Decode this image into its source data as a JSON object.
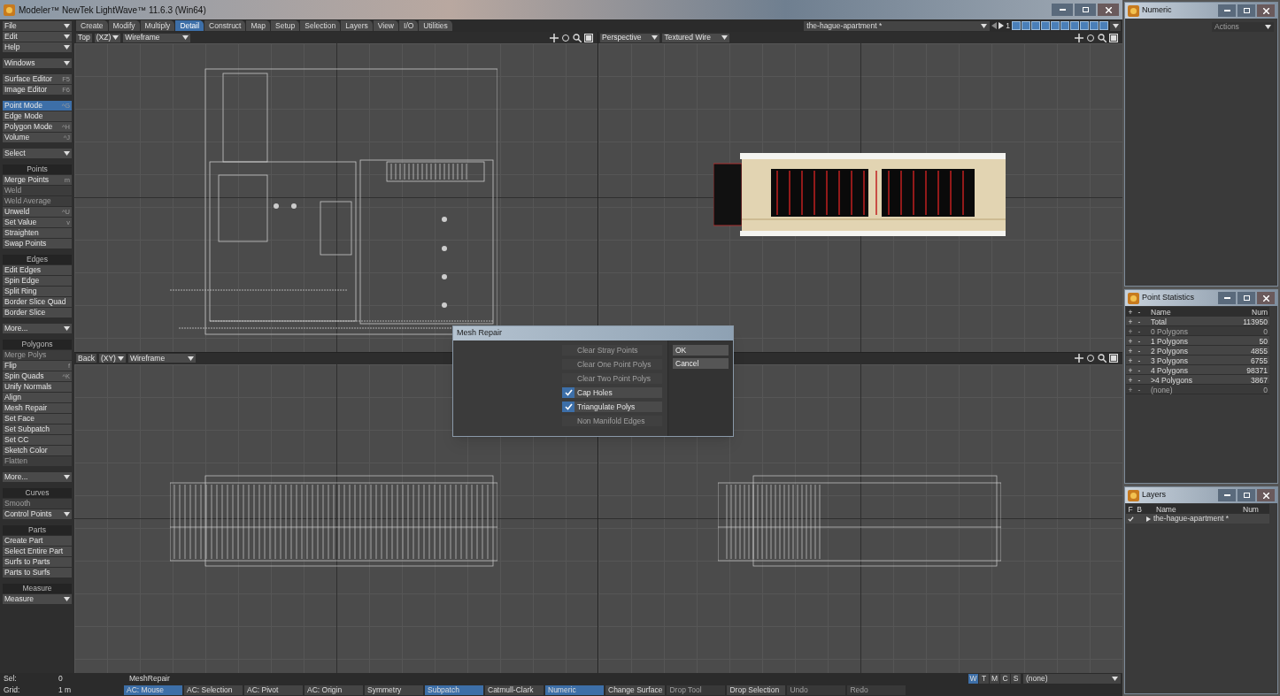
{
  "window": {
    "title": "Modeler™ NewTek LightWave™ 11.6.3 (Win64)"
  },
  "sidebar": {
    "groups": [
      {
        "items": [
          {
            "kind": "dropdown",
            "label": "File"
          },
          {
            "kind": "dropdown",
            "label": "Edit"
          },
          {
            "kind": "dropdown",
            "label": "Help"
          }
        ]
      },
      {
        "items": [
          {
            "kind": "dropdown",
            "label": "Windows"
          }
        ]
      },
      {
        "items": [
          {
            "kind": "button",
            "label": "Surface Editor",
            "shortcut": "F5",
            "selected": false,
            "disabled": false
          },
          {
            "kind": "button",
            "label": "Image Editor",
            "shortcut": "F6",
            "selected": false,
            "disabled": false
          }
        ]
      },
      {
        "items": [
          {
            "kind": "button",
            "label": "Point Mode",
            "shortcut": "^G",
            "selected": true,
            "disabled": false
          },
          {
            "kind": "button",
            "label": "Edge Mode",
            "selected": false,
            "disabled": false
          },
          {
            "kind": "button",
            "label": "Polygon Mode",
            "shortcut": "^H",
            "selected": false,
            "disabled": false
          },
          {
            "kind": "button",
            "label": "Volume",
            "shortcut": "^J",
            "selected": false,
            "disabled": false
          }
        ]
      },
      {
        "items": [
          {
            "kind": "dropdown",
            "label": "Select"
          }
        ]
      },
      {
        "items": [
          {
            "kind": "header",
            "label": "Points"
          },
          {
            "kind": "button",
            "label": "Merge Points",
            "shortcut": "m",
            "selected": false,
            "disabled": false
          },
          {
            "kind": "button",
            "label": "Weld",
            "selected": false,
            "disabled": true
          },
          {
            "kind": "button",
            "label": "Weld Average",
            "selected": false,
            "disabled": true
          },
          {
            "kind": "button",
            "label": "Unweld",
            "shortcut": "^U",
            "selected": false,
            "disabled": false
          },
          {
            "kind": "button",
            "label": "Set Value",
            "shortcut": "v",
            "selected": false,
            "disabled": false
          },
          {
            "kind": "button",
            "label": "Straighten",
            "selected": false,
            "disabled": false
          },
          {
            "kind": "button",
            "label": "Swap Points",
            "selected": false,
            "disabled": false
          }
        ]
      },
      {
        "items": [
          {
            "kind": "header",
            "label": "Edges"
          },
          {
            "kind": "button",
            "label": "Edit Edges",
            "selected": false,
            "disabled": false
          },
          {
            "kind": "button",
            "label": "Spin Edge",
            "selected": false,
            "disabled": false
          },
          {
            "kind": "button",
            "label": "Split Ring",
            "selected": false,
            "disabled": false
          },
          {
            "kind": "button",
            "label": "Border Slice Quad",
            "selected": false,
            "disabled": false
          },
          {
            "kind": "button",
            "label": "Border Slice",
            "selected": false,
            "disabled": false
          }
        ]
      },
      {
        "items": [
          {
            "kind": "dropdown",
            "label": "More..."
          }
        ]
      },
      {
        "items": [
          {
            "kind": "header",
            "label": "Polygons"
          },
          {
            "kind": "button",
            "label": "Merge Polys",
            "selected": false,
            "disabled": true
          },
          {
            "kind": "button",
            "label": "Flip",
            "shortcut": "f",
            "selected": false,
            "disabled": false
          },
          {
            "kind": "button",
            "label": "Spin Quads",
            "shortcut": "^K",
            "selected": false,
            "disabled": false
          },
          {
            "kind": "button",
            "label": "Unify Normals",
            "selected": false,
            "disabled": false
          },
          {
            "kind": "button",
            "label": "Align",
            "selected": false,
            "disabled": false
          },
          {
            "kind": "button",
            "label": "Mesh Repair",
            "selected": false,
            "disabled": false
          },
          {
            "kind": "button",
            "label": "Set Face",
            "selected": false,
            "disabled": false
          },
          {
            "kind": "button",
            "label": "Set Subpatch",
            "selected": false,
            "disabled": false
          },
          {
            "kind": "button",
            "label": "Set CC",
            "selected": false,
            "disabled": false
          },
          {
            "kind": "button",
            "label": "Sketch Color",
            "selected": false,
            "disabled": false
          },
          {
            "kind": "button",
            "label": "Flatten",
            "selected": false,
            "disabled": true
          }
        ]
      },
      {
        "items": [
          {
            "kind": "dropdown",
            "label": "More..."
          }
        ]
      },
      {
        "items": [
          {
            "kind": "header",
            "label": "Curves"
          },
          {
            "kind": "button",
            "label": "Smooth",
            "selected": false,
            "disabled": true
          },
          {
            "kind": "dropdown",
            "label": "Control Points"
          }
        ]
      },
      {
        "items": [
          {
            "kind": "header",
            "label": "Parts"
          },
          {
            "kind": "button",
            "label": "Create Part",
            "selected": false,
            "disabled": false
          },
          {
            "kind": "button",
            "label": "Select Entire Part",
            "selected": false,
            "disabled": false
          },
          {
            "kind": "button",
            "label": "Surfs to Parts",
            "selected": false,
            "disabled": false
          },
          {
            "kind": "button",
            "label": "Parts to Surfs",
            "selected": false,
            "disabled": false
          }
        ]
      },
      {
        "items": [
          {
            "kind": "header",
            "label": "Measure"
          },
          {
            "kind": "dropdown",
            "label": "Measure"
          }
        ]
      }
    ]
  },
  "tabs": [
    {
      "label": "Create",
      "selected": false
    },
    {
      "label": "Modify",
      "selected": false
    },
    {
      "label": "Multiply",
      "selected": false
    },
    {
      "label": "Detail",
      "selected": true
    },
    {
      "label": "Construct",
      "selected": false
    },
    {
      "label": "Map",
      "selected": false
    },
    {
      "label": "Setup",
      "selected": false
    },
    {
      "label": "Selection",
      "selected": false
    },
    {
      "label": "Layers",
      "selected": false
    },
    {
      "label": "View",
      "selected": false
    },
    {
      "label": "I/O",
      "selected": false
    },
    {
      "label": "Utilities",
      "selected": false
    }
  ],
  "scene": {
    "name": "the-hague-apartment *",
    "layer": "1"
  },
  "viewports": [
    {
      "view": "Top",
      "axes": "(XZ)",
      "mode": "Wireframe",
      "kind": "plan"
    },
    {
      "view": "Perspective",
      "mode": "Textured Wire",
      "kind": "perspective"
    },
    {
      "view": "Back",
      "axes": "(XY)",
      "mode": "Wireframe",
      "kind": "back"
    },
    {
      "kind": "side"
    }
  ],
  "dialog": {
    "title": "Mesh Repair",
    "options": [
      {
        "label": "Clear Stray Points",
        "checked": false,
        "disabled": true
      },
      {
        "label": "Clear One Point Polys",
        "checked": false,
        "disabled": true
      },
      {
        "label": "Clear Two Point Polys",
        "checked": false,
        "disabled": true
      },
      {
        "label": "Cap Holes",
        "checked": true,
        "disabled": false
      },
      {
        "label": "Triangulate Polys",
        "checked": true,
        "disabled": false
      },
      {
        "label": "Non Manifold Edges",
        "checked": false,
        "disabled": true
      }
    ],
    "buttons": [
      "OK",
      "Cancel"
    ]
  },
  "status_bar": {
    "row_1": [
      {
        "kind": "label",
        "text": "Sel:"
      },
      {
        "kind": "value",
        "text": "0"
      },
      {
        "kind": "value",
        "text": "MeshRepair"
      }
    ],
    "mode_buttons": [
      {
        "label": "W",
        "selected": true
      },
      {
        "label": "T",
        "selected": false
      },
      {
        "label": "M",
        "selected": false
      },
      {
        "label": "C",
        "selected": false
      },
      {
        "label": "S",
        "selected": false
      }
    ],
    "surface": "(none)",
    "row_2": [
      {
        "kind": "label",
        "text": "Grid:"
      },
      {
        "kind": "value",
        "text": "1 m"
      },
      {
        "kind": "button",
        "text": "AC: Mouse",
        "selected": true,
        "disabled": false
      },
      {
        "kind": "button",
        "text": "AC: Selection",
        "selected": false,
        "disabled": false
      },
      {
        "kind": "button",
        "text": "AC: Pivot",
        "selected": false,
        "disabled": false
      },
      {
        "kind": "button",
        "text": "AC: Origin",
        "selected": false,
        "disabled": false
      },
      {
        "kind": "button",
        "text": "Symmetry",
        "selected": false,
        "disabled": false
      },
      {
        "kind": "button",
        "text": "Subpatch",
        "selected": true,
        "disabled": false
      },
      {
        "kind": "button",
        "text": "Catmull-Clark",
        "selected": false,
        "disabled": false
      },
      {
        "kind": "button",
        "text": "Numeric",
        "selected": true,
        "disabled": false
      },
      {
        "kind": "button",
        "text": "Change Surface",
        "selected": false,
        "disabled": false
      },
      {
        "kind": "button",
        "text": "Drop Tool",
        "selected": false,
        "disabled": true
      },
      {
        "kind": "button",
        "text": "Drop Selection",
        "selected": false,
        "disabled": false
      },
      {
        "kind": "button",
        "text": "Undo",
        "selected": false,
        "disabled": true
      },
      {
        "kind": "button",
        "text": "Redo",
        "selected": false,
        "disabled": true
      }
    ]
  },
  "numeric": {
    "title": "Numeric",
    "actions": "Actions",
    "actions_disabled": true
  },
  "point_statistics": {
    "title": "Point Statistics",
    "columns": [
      "+",
      "-",
      "Name",
      "Num"
    ],
    "rows": [
      {
        "add": "+",
        "remove": "-",
        "name": "Total",
        "num": "113950",
        "disabled": false
      },
      {
        "add": "+",
        "remove": "-",
        "name": "0 Polygons",
        "num": "0",
        "disabled": true
      },
      {
        "add": "+",
        "remove": "-",
        "name": "1 Polygons",
        "num": "50",
        "disabled": false
      },
      {
        "add": "+",
        "remove": "-",
        "name": "2 Polygons",
        "num": "4855",
        "disabled": false
      },
      {
        "add": "+",
        "remove": "-",
        "name": "3 Polygons",
        "num": "6755",
        "disabled": false
      },
      {
        "add": "+",
        "remove": "-",
        "name": "4 Polygons",
        "num": "98371",
        "disabled": false
      },
      {
        "add": "+",
        "remove": "-",
        "name": ">4 Polygons",
        "num": "3867",
        "disabled": false
      },
      {
        "add": "+",
        "remove": "-",
        "name": "(none)",
        "num": "0",
        "disabled": true
      }
    ]
  },
  "layers": {
    "title": "Layers",
    "columns": [
      "F",
      "B",
      "Name",
      "Num"
    ],
    "rows": [
      {
        "name": "the-hague-apartment *",
        "foreground": true
      }
    ]
  }
}
